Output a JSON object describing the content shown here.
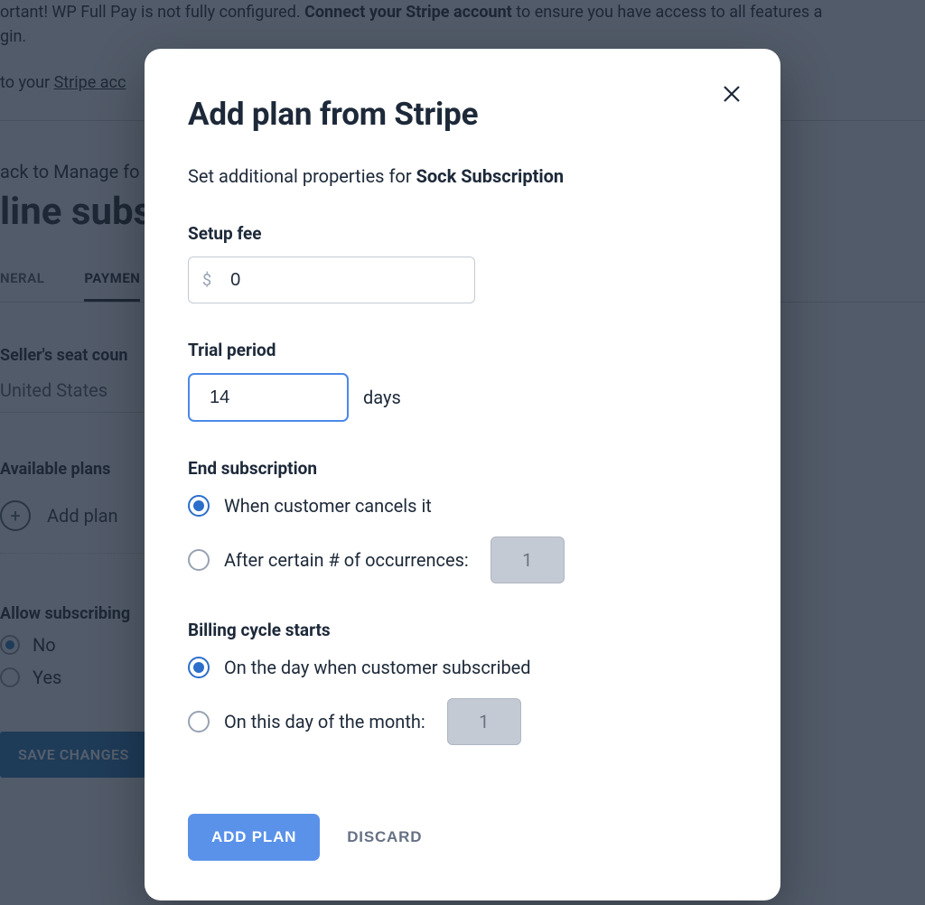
{
  "bg": {
    "notice_1a": "ortant! WP Full Pay is not fully configured. ",
    "notice_1b": "Connect your Stripe account",
    "notice_1c": " to ensure you have access to all features a",
    "notice_2": "gin.",
    "notice_3a": "to your ",
    "notice_3b": "Stripe acc",
    "back": "ack to Manage fo",
    "title": "line subs",
    "tab_general": "NERAL",
    "tab_payment": "PAYMEN",
    "seat_label": "Seller's seat coun",
    "seat_value": "United States",
    "available_plans": "Available plans",
    "add_plan": "Add plan",
    "allow_label": "Allow subscribing",
    "no": "No",
    "yes": "Yes",
    "save": "SAVE CHANGES"
  },
  "modal": {
    "title": "Add plan from Stripe",
    "subtitle_prefix": "Set additional properties for ",
    "plan_name": "Sock Subscription",
    "setup_fee": {
      "label": "Setup fee",
      "currency": "$",
      "value": "0"
    },
    "trial": {
      "label": "Trial period",
      "value": "14",
      "unit": "days"
    },
    "end_sub": {
      "label": "End subscription",
      "opt1": "When customer cancels it",
      "opt2": "After certain # of occurrences:",
      "opt2_value": "1"
    },
    "billing": {
      "label": "Billing cycle starts",
      "opt1": "On the day when customer subscribed",
      "opt2": "On this day of the month:",
      "opt2_value": "1"
    },
    "actions": {
      "primary": "ADD PLAN",
      "secondary": "DISCARD"
    }
  }
}
